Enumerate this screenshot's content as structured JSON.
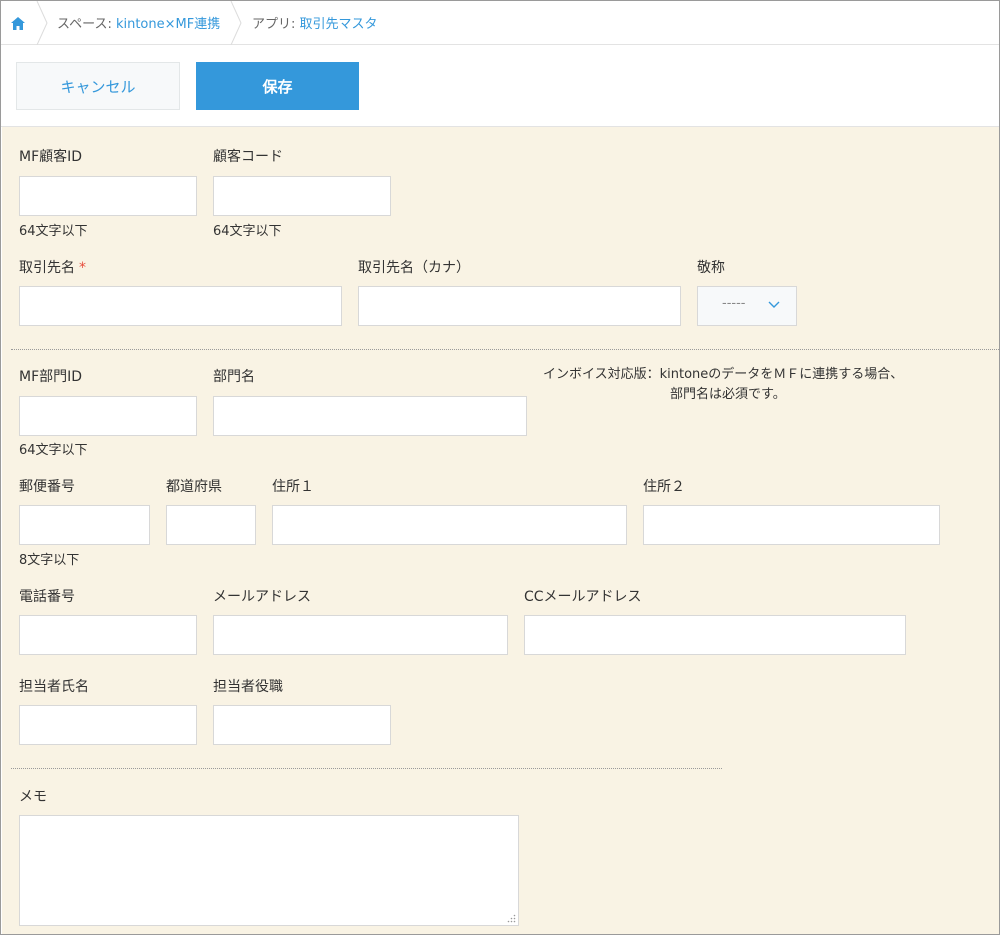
{
  "breadcrumb": {
    "space_prefix": "スペース: ",
    "space_name": "kintone×MF連携",
    "app_prefix": "アプリ: ",
    "app_name": "取引先マスタ"
  },
  "toolbar": {
    "cancel_label": "キャンセル",
    "save_label": "保存"
  },
  "fields": {
    "mf_customer_id": {
      "label": "MF顧客ID",
      "note": "64文字以下",
      "value": ""
    },
    "customer_code": {
      "label": "顧客コード",
      "note": "64文字以下",
      "value": ""
    },
    "partner_name": {
      "label": "取引先名",
      "required_mark": "*",
      "value": ""
    },
    "partner_name_kana": {
      "label": "取引先名（カナ）",
      "value": ""
    },
    "honorific": {
      "label": "敬称",
      "selected": "-----"
    },
    "mf_department_id": {
      "label": "MF部門ID",
      "note": "64文字以下",
      "value": ""
    },
    "department_name": {
      "label": "部門名",
      "value": ""
    },
    "invoice_hint_line1": "インボイス対応版：kintoneのデータをＭＦに連携する場合、",
    "invoice_hint_line2": "部門名は必須です。",
    "postal_code": {
      "label": "郵便番号",
      "note": "8文字以下",
      "value": ""
    },
    "prefecture": {
      "label": "都道府県",
      "value": ""
    },
    "address1": {
      "label": "住所１",
      "value": ""
    },
    "address2": {
      "label": "住所２",
      "value": ""
    },
    "phone": {
      "label": "電話番号",
      "value": ""
    },
    "email": {
      "label": "メールアドレス",
      "value": ""
    },
    "cc_email": {
      "label": "CCメールアドレス",
      "value": ""
    },
    "contact_name": {
      "label": "担当者氏名",
      "value": ""
    },
    "contact_title": {
      "label": "担当者役職",
      "value": ""
    },
    "memo": {
      "label": "メモ",
      "value": ""
    }
  },
  "colors": {
    "accent": "#3498db",
    "form_background": "#f9f3e4",
    "required": "#e74c3c"
  },
  "icons": {
    "home": "home-icon",
    "select_arrow": "chevron-down-icon",
    "resize": "resize-grip-icon"
  }
}
